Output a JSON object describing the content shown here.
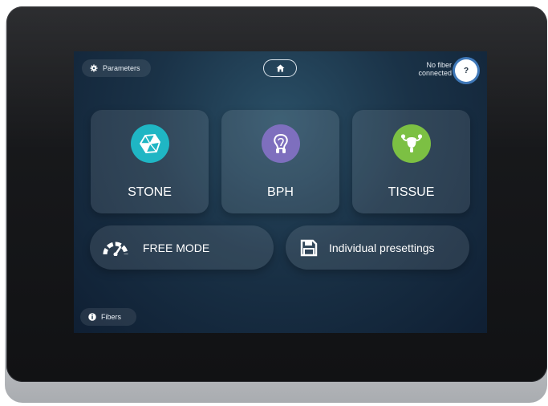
{
  "topbar": {
    "parameters_label": "Parameters",
    "fiber_status_line1": "No fiber",
    "fiber_status_line2": "connected",
    "help_label": "?"
  },
  "modes": [
    {
      "label": "STONE",
      "icon": "stone-icon",
      "color": "#1fb6c4"
    },
    {
      "label": "BPH",
      "icon": "prostate-icon",
      "color": "#7e6fbe"
    },
    {
      "label": "TISSUE",
      "icon": "tissue-icon",
      "color": "#7cc043"
    }
  ],
  "actions": {
    "free_mode_label": "FREE MODE",
    "presettings_label": "Individual presettings"
  },
  "footer": {
    "fibers_label": "Fibers"
  },
  "colors": {
    "screen_bg": "#1a3247",
    "accent_blue": "#3f78b8"
  }
}
